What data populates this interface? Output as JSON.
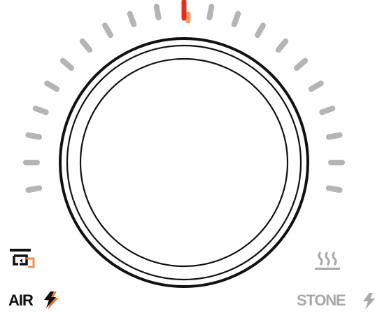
{
  "dial": {
    "tick_count": 21,
    "selected_tick": 10,
    "tick_color": "#b5b5b5",
    "selected_color": "#e42d1c",
    "selected_glow_color": "#f28a4a"
  },
  "modes": {
    "left_label": "AIR",
    "right_label": "STONE",
    "accent_color": "#f07a33",
    "left_label_color": "#111111",
    "right_label_color": "#a8a8a8"
  },
  "icons": {
    "top_left": "convection-fan-icon",
    "bottom_left": "lightning-bolt-icon",
    "top_right": "radiant-heat-icon",
    "bottom_right": "lightning-bolt-icon"
  }
}
